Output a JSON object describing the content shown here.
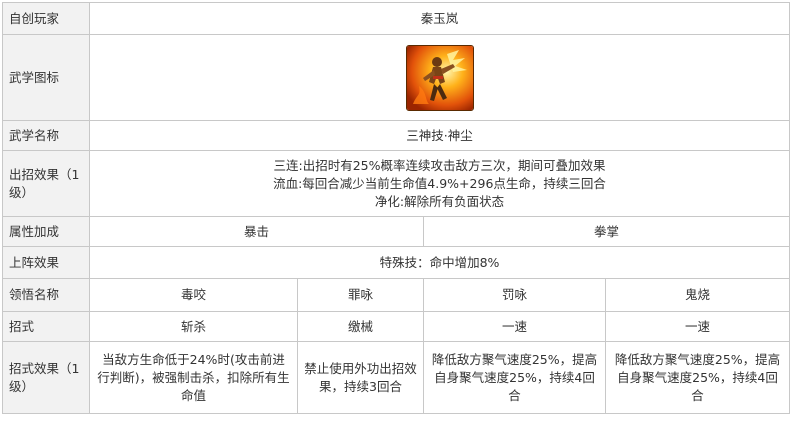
{
  "rows": {
    "player": {
      "label": "自创玩家",
      "value": "秦玉岚"
    },
    "icon": {
      "label": "武学图标",
      "icon_name": "fighter-fire-skill-icon"
    },
    "skill_name": {
      "label": "武学名称",
      "value": "三神技·神尘"
    },
    "effect": {
      "label": "出招效果（1级）",
      "lines": [
        "三连:出招时有25%概率连续攻击敌方三次，期间可叠加效果",
        "流血:每回合减少当前生命值4.9%+296点生命，持续三回合",
        "净化:解除所有负面状态"
      ]
    },
    "attribute": {
      "label": "属性加成",
      "values": [
        "暴击",
        "拳掌"
      ]
    },
    "formation": {
      "label": "上阵效果",
      "value": "特殊技：命中增加8%"
    },
    "insight": {
      "label": "领悟名称",
      "values": [
        "毒咬",
        "罪咏",
        "罚咏",
        "鬼烧"
      ]
    },
    "move": {
      "label": "招式",
      "values": [
        "斩杀",
        "缴械",
        "一速",
        "一速"
      ]
    },
    "move_effect": {
      "label": "招式效果（1级）",
      "values": [
        "当敌方生命低于24%时(攻击前进行判断)，被强制击杀，扣除所有生命值",
        "禁止使用外功出招效果，持续3回合",
        "降低敌方聚气速度25%，提高自身聚气速度25%，持续4回合",
        "降低敌方聚气速度25%，提高自身聚气速度25%，持续4回合"
      ]
    }
  }
}
